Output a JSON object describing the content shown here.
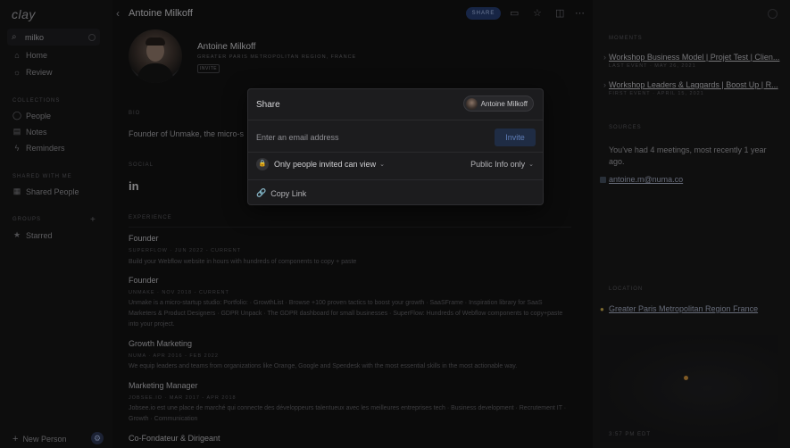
{
  "app": {
    "logo": "clay"
  },
  "search": {
    "value": "milko"
  },
  "sidebar": {
    "items": [
      {
        "label": "Home",
        "icon": "home-icon"
      },
      {
        "label": "Review",
        "icon": "sun-icon"
      }
    ],
    "collections_label": "COLLECTIONS",
    "collections": [
      {
        "label": "People",
        "icon": "person-icon"
      },
      {
        "label": "Notes",
        "icon": "note-icon"
      },
      {
        "label": "Reminders",
        "icon": "bolt-icon"
      }
    ],
    "shared_label": "SHARED WITH ME",
    "shared": [
      {
        "label": "Shared People",
        "icon": "grid-icon"
      }
    ],
    "groups_label": "GROUPS",
    "groups": [
      {
        "label": "Starred",
        "icon": "star-icon"
      }
    ],
    "new_person": "New Person"
  },
  "header": {
    "title": "Antoine Milkoff",
    "share_label": "SHARE"
  },
  "profile": {
    "name": "Antoine Milkoff",
    "location": "GREATER PARIS METROPOLITAN REGION, FRANCE",
    "badge": "INVITE",
    "bio_label": "BIO",
    "bio": "Founder of Unmake, the micro-s",
    "social_label": "SOCIAL",
    "experience_label": "EXPERIENCE",
    "experience": [
      {
        "title": "Founder",
        "meta": "SUPERFLOW · JUN 2022 - CURRENT",
        "desc": "Build your Webflow website in hours with hundreds of components to copy + paste"
      },
      {
        "title": "Founder",
        "meta": "UNMAKE · NOV 2018 - CURRENT",
        "desc": "Unmake is a micro-startup studio: Portfolio: · GrowthList · Browse +100 proven tactics to boost your growth · SaaSFrame · Inspiration library for SaaS Marketers & Product Designers · GDPR Unpack · The GDPR dashboard for small businesses · SuperFlow: Hundreds of Webflow components to copy+paste into your project."
      },
      {
        "title": "Growth Marketing",
        "meta": "NUMA · APR 2016 - FEB 2022",
        "desc": "We equip leaders and teams from organizations like Orange, Google and Spendesk with the most essential skills in the most actionable way."
      },
      {
        "title": "Marketing Manager",
        "meta": "JOBSEE.IO · MAR 2017 - APR 2018",
        "desc": "Jobsee.io est une place de marché qui connecte des développeurs talentueux avec les meilleures entreprises tech · Business development · Recrutement IT · Growth · Communication"
      },
      {
        "title": "Co-Fondateur & Dirigeant",
        "meta": "",
        "desc": ""
      }
    ]
  },
  "right_panel": {
    "moments_label": "MOMENTS",
    "moments": [
      {
        "title": "Workshop Business Model | Projet Test | Clien...",
        "meta": "LAST EVENT · MAY 26, 2021"
      },
      {
        "title": "Workshop Leaders & Laggards | Boost Up | R...",
        "meta": "FIRST EVENT · APRIL 15, 2021"
      }
    ],
    "sources_label": "SOURCES",
    "sources_text": "You've had 4 meetings, most recently 1 year ago.",
    "email": "antoine.m@numa.co",
    "location_label": "LOCATION",
    "location": "Greater Paris Metropolitan Region France",
    "map_time": "3:57 PM EDT"
  },
  "share_modal": {
    "title": "Share",
    "owner": "Antoine Milkoff",
    "email_placeholder": "Enter an email address",
    "invite_label": "Invite",
    "permission": "Only people invited can view",
    "scope": "Public Info only",
    "copy_link": "Copy Link"
  }
}
